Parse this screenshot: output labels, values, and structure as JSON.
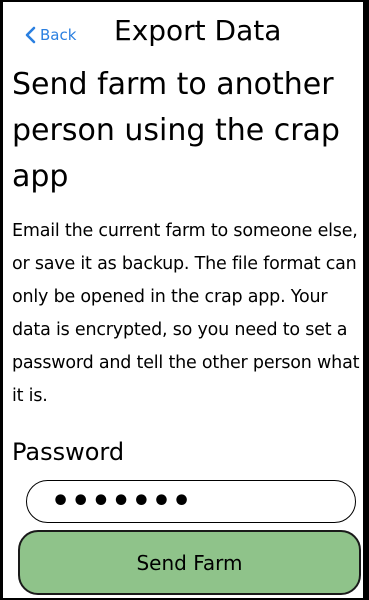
{
  "nav": {
    "back_label": "Back",
    "title": "Export Data",
    "back_icon": "chevron-left-icon",
    "accent_color": "#2a7fe0"
  },
  "main": {
    "heading": "Send farm to another person using the crap app",
    "description": "Email the current farm to someone else, or save it as backup. The file format can only be opened in the crap app. Your data is encrypted, so you need to set a password and tell the other person what it is."
  },
  "password": {
    "label": "Password",
    "value": "•••••••"
  },
  "actions": {
    "send_label": "Send Farm",
    "button_color": "#8fc38a"
  }
}
